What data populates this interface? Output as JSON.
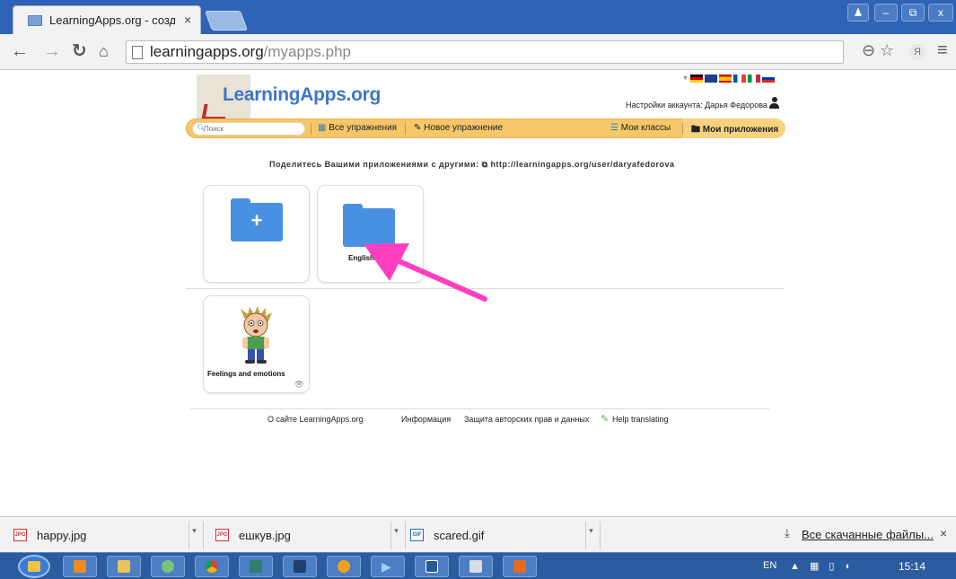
{
  "browser": {
    "tab_title": "LearningApps.org - созда",
    "tab_close": "×",
    "url_host": "learningapps.org",
    "url_path": "/myapps.php",
    "window_controls": {
      "minimize": "–",
      "maximize": "⧉",
      "close": "x",
      "profile": "♟"
    }
  },
  "site": {
    "logo_text": "LearningApps.org",
    "account_label": "Настройки аккаунта: Дарья Федорова",
    "search_placeholder": "Поиск",
    "nav": {
      "all_exercises": "Все упражнения",
      "new_exercise": "Новое упражнение",
      "my_classes": "Мои классы",
      "my_apps": "Мои приложения"
    },
    "share_line": "Поделитесь Вашими приложениями с другими: ⧉ http://learningapps.org/user/daryafedorova"
  },
  "cards": {
    "new_folder_symbol": "+",
    "folder_label": "English",
    "app_label": "Feelings and emotions"
  },
  "footer": {
    "about": "О сайте LearningApps.org",
    "info": "Информация",
    "privacy": "Защита авторских прав и данных",
    "help": "Help translating"
  },
  "downloads": {
    "items": [
      {
        "name": "happy.jpg",
        "type": "JPG"
      },
      {
        "name": "ешкув.jpg",
        "type": "JPG"
      },
      {
        "name": "scared.gif",
        "type": "GIF"
      }
    ],
    "show_all": "Все скачанные файлы...",
    "close": "×"
  },
  "taskbar": {
    "lang": "EN",
    "time": "15:14"
  },
  "colors": {
    "accent_blue": "#4a90e2",
    "nav_yellow": "#f5c66a",
    "annotation_arrow": "#ff3fbf"
  }
}
